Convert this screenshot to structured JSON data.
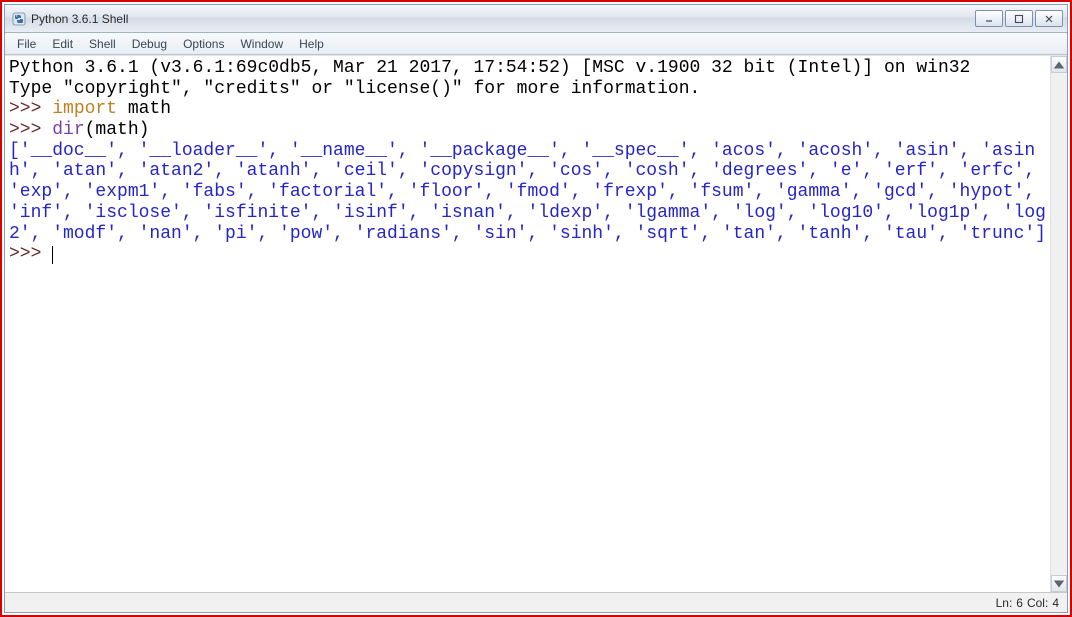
{
  "window": {
    "title": "Python 3.6.1 Shell"
  },
  "menu": {
    "file": "File",
    "edit": "Edit",
    "shell": "Shell",
    "debug": "Debug",
    "options": "Options",
    "window": "Window",
    "help": "Help"
  },
  "shell": {
    "banner_line1": "Python 3.6.1 (v3.6.1:69c0db5, Mar 21 2017, 17:54:52) [MSC v.1900 32 bit (Intel)] on win32",
    "banner_line2": "Type \"copyright\", \"credits\" or \"license()\" for more information.",
    "prompt": ">>> ",
    "import_kw": "import",
    "import_target": " math",
    "dir_call_fn": "dir",
    "dir_call_rest": "(math)",
    "dir_output": "['__doc__', '__loader__', '__name__', '__package__', '__spec__', 'acos', 'acosh', 'asin', 'asinh', 'atan', 'atan2', 'atanh', 'ceil', 'copysign', 'cos', 'cosh', 'degrees', 'e', 'erf', 'erfc', 'exp', 'expm1', 'fabs', 'factorial', 'floor', 'fmod', 'frexp', 'fsum', 'gamma', 'gcd', 'hypot', 'inf', 'isclose', 'isfinite', 'isinf', 'isnan', 'ldexp', 'lgamma', 'log', 'log10', 'log1p', 'log2', 'modf', 'nan', 'pi', 'pow', 'radians', 'sin', 'sinh', 'sqrt', 'tan', 'tanh', 'tau', 'trunc']"
  },
  "status": {
    "ln_label": "Ln:",
    "ln_value": "6",
    "col_label": "Col:",
    "col_value": "4"
  }
}
